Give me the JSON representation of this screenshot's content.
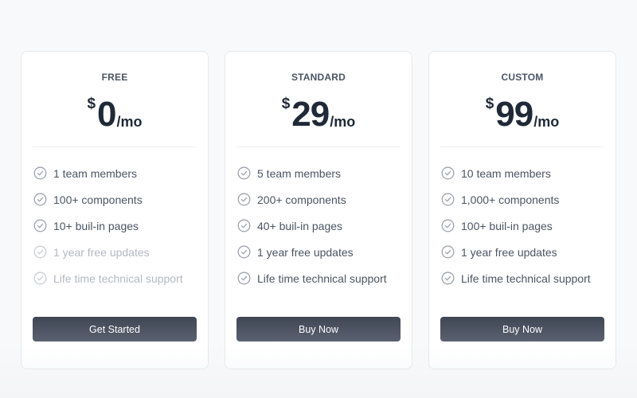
{
  "plans": [
    {
      "name": "FREE",
      "currency": "$",
      "amount": "0",
      "period": "/mo",
      "features": [
        {
          "label": "1 team members",
          "enabled": true
        },
        {
          "label": "100+ components",
          "enabled": true
        },
        {
          "label": "10+ buil-in pages",
          "enabled": true
        },
        {
          "label": "1 year free updates",
          "enabled": false
        },
        {
          "label": "Life time technical support",
          "enabled": false
        }
      ],
      "button_label": "Get Started"
    },
    {
      "name": "STANDARD",
      "currency": "$",
      "amount": "29",
      "period": "/mo",
      "features": [
        {
          "label": "5 team members",
          "enabled": true
        },
        {
          "label": "200+ components",
          "enabled": true
        },
        {
          "label": "40+ buil-in pages",
          "enabled": true
        },
        {
          "label": "1 year free updates",
          "enabled": true
        },
        {
          "label": "Life time technical support",
          "enabled": true
        }
      ],
      "button_label": "Buy Now"
    },
    {
      "name": "CUSTOM",
      "currency": "$",
      "amount": "99",
      "period": "/mo",
      "features": [
        {
          "label": "10 team members",
          "enabled": true
        },
        {
          "label": "1,000+ components",
          "enabled": true
        },
        {
          "label": "100+ buil-in pages",
          "enabled": true
        },
        {
          "label": "1 year free updates",
          "enabled": true
        },
        {
          "label": "Life time technical support",
          "enabled": true
        }
      ],
      "button_label": "Buy Now"
    }
  ],
  "icons": {
    "feature": "check-circle-icon"
  },
  "colors": {
    "button": "#4b5160",
    "text_primary": "#1f2937",
    "text_muted": "#b3b8c2"
  }
}
